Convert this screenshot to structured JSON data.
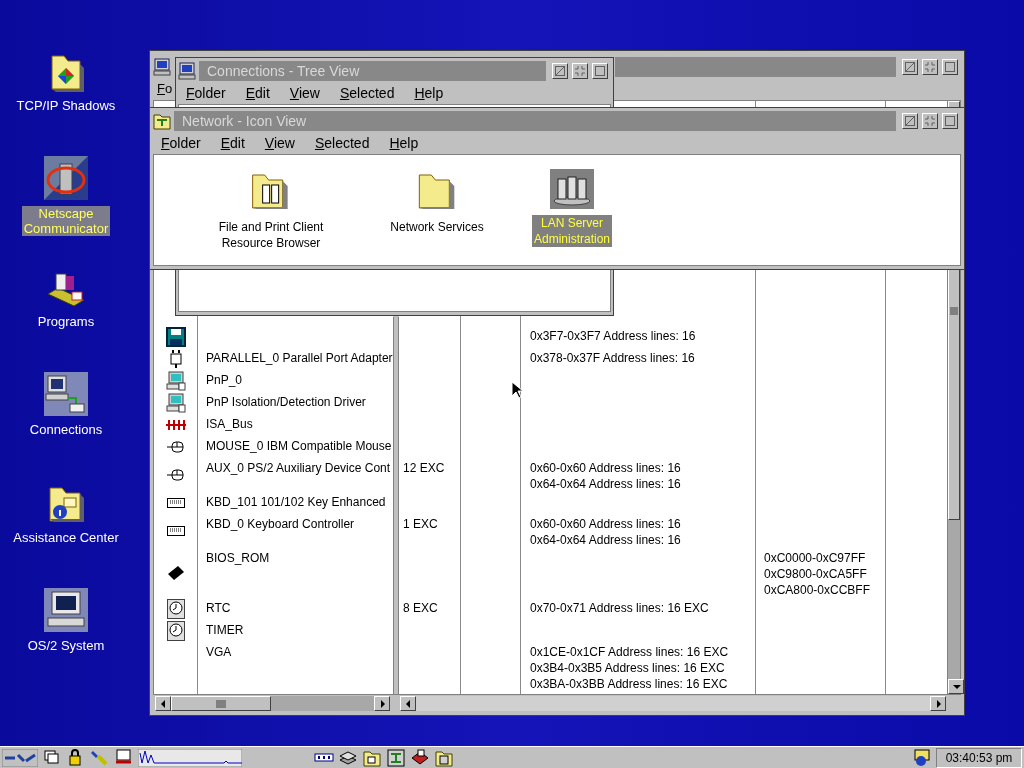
{
  "desktop_icons": [
    {
      "label": [
        "TCP/IP Shadows"
      ],
      "selected": false
    },
    {
      "label": [
        "Netscape",
        "Communicator"
      ],
      "selected": true
    },
    {
      "label": [
        "Programs"
      ],
      "selected": false
    },
    {
      "label": [
        "Connections"
      ],
      "selected": false
    },
    {
      "label": [
        "Assistance Center"
      ],
      "selected": false
    },
    {
      "label": [
        "OS/2 System"
      ],
      "selected": false
    }
  ],
  "hardware_window": {
    "menu": [
      "Fo"
    ],
    "rows": [
      {
        "io": [
          "0x3F7-0x3F7 Address lines: 16"
        ]
      },
      {
        "name": "PARALLEL_0 Parallel Port Adapter",
        "io": [
          "0x378-0x37F Address lines: 16"
        ]
      },
      {
        "name": "PnP_0"
      },
      {
        "name": "PnP Isolation/Detection Driver"
      },
      {
        "name": "ISA_Bus"
      },
      {
        "name": "MOUSE_0 IBM Compatible Mouse"
      },
      {
        "name": "AUX_0 PS/2 Auxiliary Device Cont",
        "irq": "12 EXC",
        "io": [
          "0x60-0x60 Address lines: 16",
          "0x64-0x64 Address lines: 16"
        ]
      },
      {
        "name": "KBD_101 101/102 Key Enhanced"
      },
      {
        "name": "KBD_0 Keyboard Controller",
        "irq": "1 EXC",
        "io": [
          "0x60-0x60 Address lines: 16",
          "0x64-0x64 Address lines: 16"
        ]
      },
      {
        "name": "BIOS_ROM",
        "memory": [
          "0xC0000-0xC97FF",
          "0xC9800-0xCA5FF",
          "0xCA800-0xCCBFF"
        ]
      },
      {
        "name": "RTC",
        "irq": "8 EXC",
        "io": [
          "0x70-0x71 Address lines: 16  EXC"
        ]
      },
      {
        "name": "TIMER"
      },
      {
        "name": "VGA",
        "io": [
          "0x1CE-0x1CF Address lines: 16  EXC",
          "0x3B4-0x3B5 Address lines: 16  EXC",
          "0x3BA-0x3BB Address lines: 16  EXC"
        ]
      }
    ]
  },
  "connections_window": {
    "title": "Connections - Tree View",
    "menu": [
      "Folder",
      "Edit",
      "View",
      "Selected",
      "Help"
    ]
  },
  "network_window": {
    "title": "Network - Icon View",
    "menu": [
      "Folder",
      "Edit",
      "View",
      "Selected",
      "Help"
    ],
    "items": [
      {
        "label": [
          "File and Print Client",
          "Resource Browser"
        ],
        "selected": false
      },
      {
        "label": [
          "Network Services"
        ],
        "selected": false
      },
      {
        "label": [
          "LAN Server",
          "Administration"
        ],
        "selected": true
      }
    ]
  },
  "taskbar": {
    "clock": "03:40:53 pm"
  }
}
